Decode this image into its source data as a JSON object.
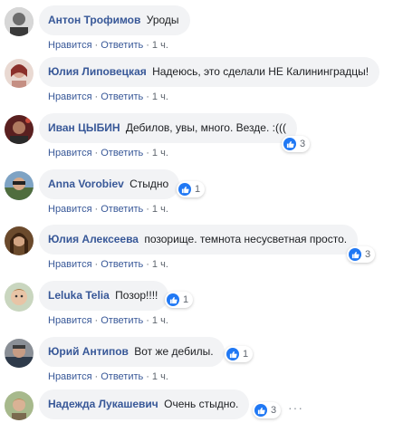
{
  "comments": [
    {
      "author": "Антон Трофимов",
      "text": "Уроды",
      "like": "Нравится",
      "reply": "Ответить",
      "time": "1 ч.",
      "reactions": ""
    },
    {
      "author": "Юлия Липовецкая",
      "text": "Надеюсь, это сделали НЕ Калининградцы!",
      "like": "Нравится",
      "reply": "Ответить",
      "time": "1 ч.",
      "reactions": ""
    },
    {
      "author": "Иван ЦЫБИН",
      "text": "Дебилов, увы, много. Везде. :(((",
      "like": "Нравится",
      "reply": "Ответить",
      "time": "1 ч.",
      "reactions": "3"
    },
    {
      "author": "Anna Vorobiev",
      "text": "Стыдно",
      "like": "Нравится",
      "reply": "Ответить",
      "time": "1 ч.",
      "reactions": "1"
    },
    {
      "author": "Юлия Алексеева",
      "text": "позорище. темнота несусветная просто.",
      "like": "Нравится",
      "reply": "Ответить",
      "time": "1 ч.",
      "reactions": "3"
    },
    {
      "author": "Leluka Telia",
      "text": "Позор!!!!",
      "like": "Нравится",
      "reply": "Ответить",
      "time": "1 ч.",
      "reactions": "1"
    },
    {
      "author": "Юрий Антипов",
      "text": "Вот же дебилы.",
      "like": "Нравится",
      "reply": "Ответить",
      "time": "1 ч.",
      "reactions": "1"
    },
    {
      "author": "Надежда Лукашевич",
      "text": "Очень стыдно.",
      "like": "",
      "reply": "",
      "time": "",
      "reactions": "3"
    }
  ],
  "more_icon": "ellipsis-icon",
  "like_icon": "thumbs-up-icon",
  "colors": {
    "author": "#385898",
    "bubble": "#f2f3f5",
    "like": "#2078f4",
    "meta": "#606770"
  }
}
